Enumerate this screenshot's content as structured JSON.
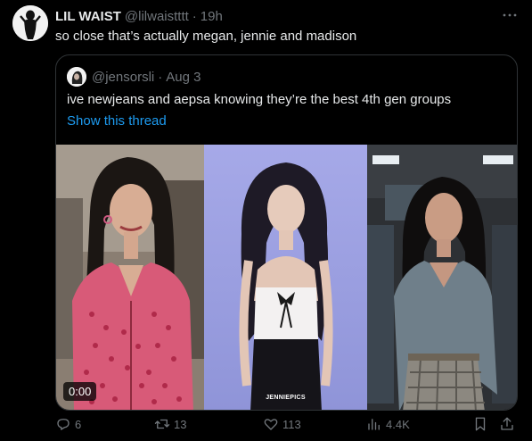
{
  "tweet": {
    "display_name": "LIL WAIST",
    "handle": "@lilwaistttt",
    "separator": "·",
    "time": "19h",
    "text": "so close that’s actually megan, jennie and madison",
    "more_icon": "more-icon"
  },
  "quote": {
    "handle": "@jensorsli",
    "separator": "·",
    "date": "Aug 3",
    "text": "ive newjeans and aepsa knowing they’re the best 4th gen groups",
    "show_thread": "Show this thread",
    "media": {
      "video_duration": "0:00",
      "watermark": "JENNIEPICS"
    }
  },
  "actions": {
    "replies": "6",
    "reposts": "13",
    "likes": "113",
    "views": "4.4K"
  },
  "colors": {
    "background": "#000000",
    "text": "#e7e9ea",
    "secondary": "#71767b",
    "link": "#1d9bf0",
    "border": "#2f3336"
  }
}
